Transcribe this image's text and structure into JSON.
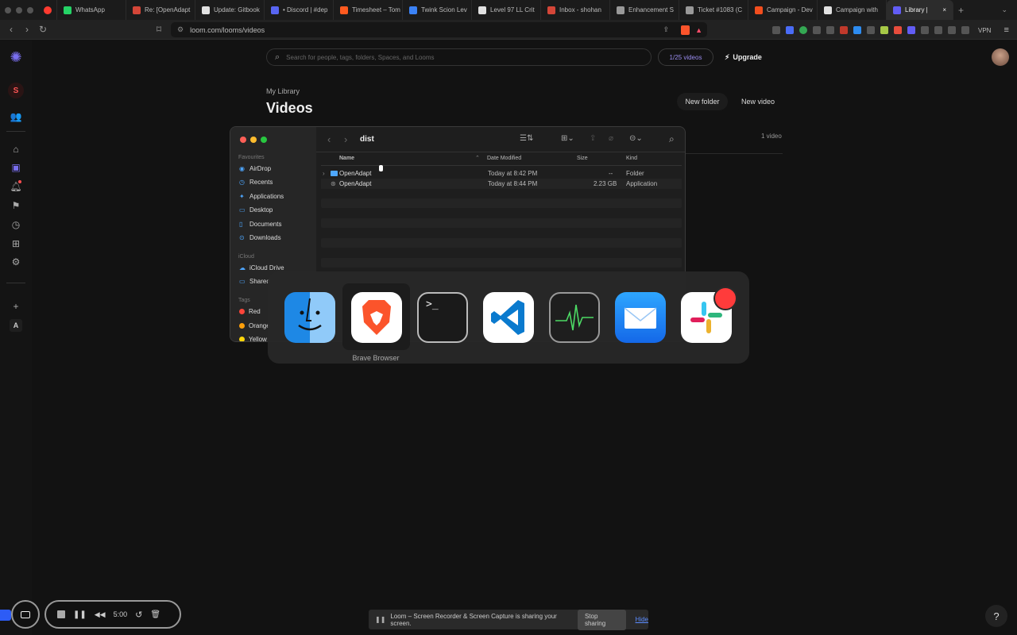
{
  "browser": {
    "tabs": [
      {
        "label": "WhatsApp",
        "color": "#25d366"
      },
      {
        "label": "Re: [OpenAdapt",
        "color": "#d44638"
      },
      {
        "label": "Update: Gitbook",
        "color": "#e0e0e0"
      },
      {
        "label": "• Discord | #dep",
        "color": "#5865f2"
      },
      {
        "label": "Timesheet – Tom",
        "color": "#ff5a1f"
      },
      {
        "label": "Twink Scion Lev",
        "color": "#3b82f6"
      },
      {
        "label": "Level 97 LL Crit",
        "color": "#e0e0e0"
      },
      {
        "label": "Inbox - shohan",
        "color": "#d44638"
      },
      {
        "label": "Enhancement S",
        "color": "#999999"
      },
      {
        "label": "Ticket #1083 (C",
        "color": "#999999"
      },
      {
        "label": "Campaign - Dev",
        "color": "#f24e1e"
      },
      {
        "label": "Campaign with",
        "color": "#e0e0e0"
      },
      {
        "label": "Library | ",
        "color": "#625df5"
      }
    ],
    "url": "loom.com/looms/videos",
    "vpn_label": "VPN"
  },
  "sidebar": {
    "workspace_initial": "S",
    "bottom_initial": "A"
  },
  "main": {
    "search_placeholder": "Search for people, tags, folders, Spaces, and Looms",
    "quota": "1/25 videos",
    "upgrade": "Upgrade",
    "breadcrumb": "My Library",
    "title": "Videos",
    "new_folder": "New folder",
    "new_video": "New video",
    "video_count": "1 video"
  },
  "finder": {
    "path": "dist",
    "sections": {
      "favourites": "Favourites",
      "icloud": "iCloud",
      "tags": "Tags"
    },
    "favourites": [
      "AirDrop",
      "Recents",
      "Applications",
      "Desktop",
      "Documents",
      "Downloads"
    ],
    "icloud": [
      "iCloud Drive",
      "Shared"
    ],
    "tags": [
      {
        "label": "Red",
        "color": "#ff453a"
      },
      {
        "label": "Orange",
        "color": "#ff9f0a"
      },
      {
        "label": "Yellow",
        "color": "#ffd60a"
      }
    ],
    "columns": {
      "name": "Name",
      "modified": "Date Modified",
      "size": "Size",
      "kind": "Kind"
    },
    "rows": [
      {
        "name": "OpenAdapt",
        "modified": "Today at 8:42 PM",
        "size": "--",
        "kind": "Folder"
      },
      {
        "name": "OpenAdapt",
        "modified": "Today at 8:44 PM",
        "size": "2.23 GB",
        "kind": "Application"
      }
    ]
  },
  "switcher": {
    "apps": [
      "finder-icon",
      "brave-icon",
      "terminal-icon",
      "vscode-icon",
      "activity-monitor-icon",
      "mail-icon",
      "slack-icon"
    ],
    "selected_label": "Brave Browser"
  },
  "recorder": {
    "time": "5:00"
  },
  "sharebar": {
    "message": "Loom – Screen Recorder & Screen Capture is sharing your screen.",
    "stop": "Stop sharing",
    "hide": "Hide"
  },
  "help": "?"
}
